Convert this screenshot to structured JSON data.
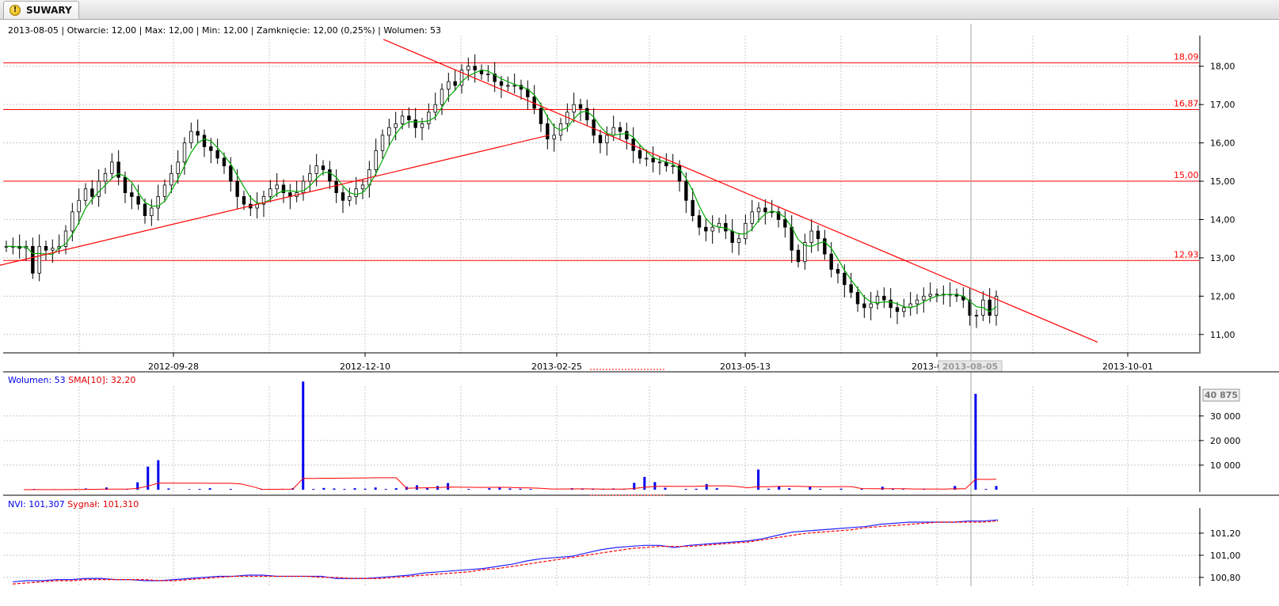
{
  "tab": {
    "label": "SUWARY",
    "icon": "warning-icon"
  },
  "price_info": "2013-08-05 | Otwarcie: 12,00 | Max: 12,00 | Min: 12,00 | Zamknięcie: 12,00 (0,25%) | Wolumen: 53",
  "volume_info": {
    "label": "Wolumen: 53",
    "sma_label": "SMA[10]: 32,20"
  },
  "nvi_info": {
    "label": "NVI: 101,307",
    "signal_label": "Sygnał: 101,310"
  },
  "colors": {
    "price_candle": "#000000",
    "sma": "#00aa00",
    "lines": "#ff0000",
    "volume": "#0000ee",
    "nvi": "#2222ff",
    "signal": "#ff0000",
    "grid": "#c8c8c8"
  },
  "chart_data": [
    {
      "type": "candlestick",
      "x_ticks": [
        "2012-09-28",
        "2012-12-10",
        "2013-02-25",
        "2013-05-13",
        "2013-08",
        "2013-10-01"
      ],
      "cursor_date_label": "2013-08-05",
      "y_ticks": [
        "11,00",
        "12,00",
        "13,00",
        "14,00",
        "15,00",
        "16,00",
        "17,00",
        "18,00"
      ],
      "y_range": [
        10.5,
        18.8
      ],
      "horizontal_levels": [
        "18,09",
        "16,87",
        "15,00",
        "12,93"
      ],
      "close": [
        13.3,
        13.3,
        13.25,
        13.3,
        12.6,
        13.3,
        13.2,
        13.25,
        13.3,
        13.7,
        14.2,
        14.5,
        14.8,
        14.6,
        15.0,
        15.2,
        15.5,
        15.1,
        14.7,
        14.6,
        14.4,
        14.1,
        14.3,
        14.6,
        14.9,
        15.2,
        15.5,
        16.0,
        16.3,
        16.2,
        15.9,
        15.8,
        15.6,
        15.4,
        15.0,
        14.6,
        14.4,
        14.3,
        14.4,
        14.6,
        14.8,
        14.9,
        14.7,
        14.6,
        14.7,
        15.0,
        15.2,
        15.4,
        15.3,
        15.0,
        14.7,
        14.5,
        14.6,
        14.8,
        14.9,
        15.3,
        15.8,
        16.2,
        16.4,
        16.5,
        16.7,
        16.6,
        16.4,
        16.5,
        16.8,
        17.0,
        17.4,
        17.6,
        17.5,
        17.9,
        18.0,
        17.9,
        17.8,
        17.8,
        17.6,
        17.5,
        17.5,
        17.5,
        17.4,
        17.2,
        16.9,
        16.5,
        16.1,
        16.2,
        16.5,
        16.8,
        17.0,
        16.9,
        16.6,
        16.2,
        16.0,
        16.2,
        16.4,
        16.3,
        16.1,
        15.8,
        15.6,
        15.6,
        15.5,
        15.5,
        15.4,
        15.4,
        15.0,
        14.5,
        14.1,
        13.8,
        13.7,
        13.8,
        13.9,
        13.7,
        13.4,
        13.5,
        13.9,
        14.2,
        14.3,
        14.2,
        14.2,
        14.0,
        13.8,
        13.2,
        12.9,
        13.4,
        13.7,
        13.5,
        13.1,
        12.7,
        12.6,
        12.3,
        12.1,
        11.8,
        11.7,
        11.8,
        12.0,
        11.9,
        11.7,
        11.6,
        11.7,
        11.8,
        11.9,
        12.0,
        12.05,
        12.05,
        12.05,
        12.05,
        12.0,
        11.9,
        11.5,
        11.5,
        11.9,
        11.5,
        12.0
      ],
      "sma_series": "green moving average",
      "trendlines": [
        {
          "from": [
            "2012-07-05",
            12.5
          ],
          "to": [
            "2013-02-18",
            16.2
          ]
        },
        {
          "from": [
            "2012-12-17",
            18.7
          ],
          "to": [
            "2013-09-15",
            10.8
          ]
        }
      ]
    },
    {
      "type": "bar",
      "series": [
        {
          "name": "Wolumen",
          "values": [
            0,
            300,
            0,
            200,
            0,
            300,
            500,
            200,
            900,
            0,
            200,
            3000,
            9400,
            12000,
            500,
            0,
            200,
            300,
            600,
            0,
            300,
            0,
            0,
            300,
            0,
            300,
            600,
            44000,
            300,
            700,
            500,
            300,
            600,
            400,
            900,
            300,
            600,
            1200,
            1800,
            900,
            1500,
            2700,
            0,
            300,
            0,
            600,
            800,
            500,
            400,
            300,
            0,
            0,
            0,
            600,
            300,
            200,
            300,
            500,
            300,
            2800,
            5200,
            3100,
            800,
            0,
            300,
            400,
            2300,
            600,
            0,
            0,
            0,
            8200,
            400,
            1400,
            600,
            0,
            1200,
            300,
            0,
            400,
            0,
            300,
            0,
            1200,
            500,
            200,
            0,
            300,
            0,
            0,
            1500,
            0,
            39000,
            300,
            1500
          ]
        }
      ],
      "sma_label": "SMA[10]",
      "y_ticks": [
        "10 000",
        "20 000",
        "30 000"
      ],
      "max_label": "40 875"
    },
    {
      "type": "line",
      "series": [
        {
          "name": "NVI",
          "values": [
            100.76,
            100.77,
            100.77,
            100.78,
            100.78,
            100.79,
            100.79,
            100.78,
            100.78,
            100.77,
            100.77,
            100.78,
            100.79,
            100.8,
            100.81,
            100.81,
            100.82,
            100.82,
            100.81,
            100.81,
            100.81,
            100.81,
            100.79,
            100.79,
            100.79,
            100.8,
            100.81,
            100.82,
            100.84,
            100.85,
            100.86,
            100.87,
            100.88,
            100.9,
            100.92,
            100.95,
            100.97,
            100.98,
            100.99,
            101.02,
            101.05,
            101.07,
            101.08,
            101.09,
            101.09,
            101.07,
            101.09,
            101.1,
            101.11,
            101.12,
            101.13,
            101.15,
            101.18,
            101.21,
            101.22,
            101.23,
            101.24,
            101.25,
            101.26,
            101.28,
            101.29,
            101.3,
            101.3,
            101.3,
            101.3,
            101.31,
            101.31,
            101.32
          ]
        },
        {
          "name": "Sygnał",
          "values": [
            100.74,
            100.75,
            100.76,
            100.77,
            100.77,
            100.78,
            100.78,
            100.78,
            100.78,
            100.78,
            100.77,
            100.77,
            100.78,
            100.79,
            100.8,
            100.81,
            100.81,
            100.81,
            100.81,
            100.81,
            100.81,
            100.8,
            100.8,
            100.79,
            100.79,
            100.79,
            100.8,
            100.81,
            100.82,
            100.83,
            100.84,
            100.85,
            100.87,
            100.88,
            100.9,
            100.92,
            100.94,
            100.96,
            100.98,
            101.0,
            101.02,
            101.04,
            101.06,
            101.07,
            101.08,
            101.08,
            101.08,
            101.09,
            101.1,
            101.11,
            101.12,
            101.14,
            101.16,
            101.18,
            101.2,
            101.21,
            101.22,
            101.23,
            101.25,
            101.26,
            101.27,
            101.28,
            101.29,
            101.3,
            101.3,
            101.3,
            101.3,
            101.31
          ]
        }
      ],
      "y_ticks": [
        "100,80",
        "101,00",
        "101,20"
      ]
    }
  ]
}
